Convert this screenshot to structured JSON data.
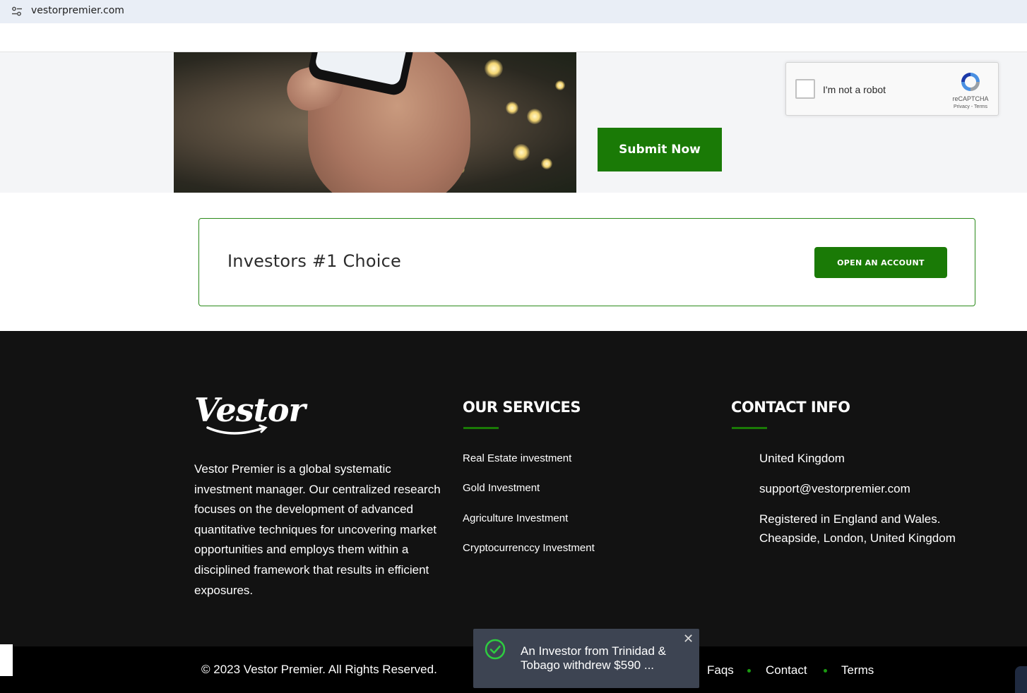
{
  "browser": {
    "url": "vestorpremier.com",
    "site_info_icon": "tune-icon"
  },
  "form": {
    "recaptcha": {
      "label": "I'm not a robot",
      "brand": "reCAPTCHA",
      "links": "Privacy - Terms"
    },
    "submit_label": "Submit Now"
  },
  "cta": {
    "title": "Investors #1 Choice",
    "button_label": "OPEN AN ACCOUNT"
  },
  "footer": {
    "logo_text": "Vestor",
    "about": "Vestor Premier is a global systematic investment manager. Our centralized research focuses on the development of advanced quantitative techniques for uncovering market opportunities and employs them within a disciplined framework that results in efficient exposures.",
    "services": {
      "title": "OUR SERVICES",
      "items": [
        "Real Estate investment",
        "Gold Investment",
        "Agriculture Investment",
        "Cryptocurrenccy Investment"
      ]
    },
    "contact": {
      "title": "CONTACT INFO",
      "country": "United Kingdom",
      "email": "support@vestorpremier.com",
      "registered": "Registered in England and Wales.",
      "address": "Cheapside, London, United Kingdom"
    },
    "copyright": "© 2023 Vestor Premier. All Rights Reserved.",
    "nav": [
      "Faqs",
      "Contact",
      "Terms"
    ]
  },
  "toast": {
    "message": "An Investor from Trinidad & Tobago withdrew $590 ...",
    "close": "✕"
  },
  "colors": {
    "accent_green": "#1a7a06",
    "footer_bg": "#121212",
    "toast_bg": "#3d4452"
  }
}
